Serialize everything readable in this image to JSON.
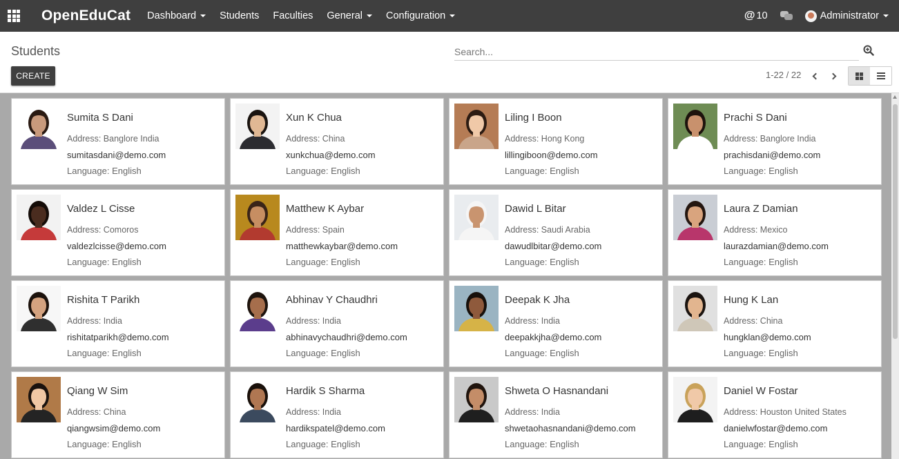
{
  "navbar": {
    "brand": "OpenEduCat",
    "menu": [
      {
        "label": "Dashboard",
        "dropdown": true
      },
      {
        "label": "Students",
        "dropdown": false
      },
      {
        "label": "Faculties",
        "dropdown": false
      },
      {
        "label": "General",
        "dropdown": true
      },
      {
        "label": "Configuration",
        "dropdown": true
      }
    ],
    "mentions_count": "10",
    "user": "Administrator"
  },
  "control_panel": {
    "breadcrumb": "Students",
    "search_placeholder": "Search...",
    "create_label": "CREATE",
    "pager": "1-22 / 22",
    "active_view": "kanban"
  },
  "students": [
    {
      "name": "Sumita S Dani",
      "address": "Address: Banglore India",
      "email": "sumitasdani@demo.com",
      "language": "Language: English",
      "skin": "#c99a7c",
      "hair": "#2a1a12",
      "bg": "#ffffff",
      "shirt": "#5b4e7a"
    },
    {
      "name": "Xun K Chua",
      "address": "Address: China",
      "email": "xunkchua@demo.com",
      "language": "Language: English",
      "skin": "#e0b894",
      "hair": "#1a1410",
      "bg": "#f3f3f3",
      "shirt": "#2b2b30"
    },
    {
      "name": "Liling I Boon",
      "address": "Address: Hong Kong",
      "email": "lillingiboon@demo.com",
      "language": "Language: English",
      "skin": "#f0c9a8",
      "hair": "#2c1b12",
      "bg": "#b57c55",
      "shirt": "#c9a58a"
    },
    {
      "name": "Prachi S Dani",
      "address": "Address: Banglore India",
      "email": "prachisdani@demo.com",
      "language": "Language: English",
      "skin": "#c8916d",
      "hair": "#1d130d",
      "bg": "#6e8c54",
      "shirt": "#ffffff"
    },
    {
      "name": "Valdez L Cisse",
      "address": "Address: Comoros",
      "email": "valdezlcisse@demo.com",
      "language": "Language: English",
      "skin": "#4a2c1f",
      "hair": "#140c08",
      "bg": "#f2f2f2",
      "shirt": "#c53a3a"
    },
    {
      "name": "Matthew K Aybar",
      "address": "Address: Spain",
      "email": "matthewkaybar@demo.com",
      "language": "Language: English",
      "skin": "#c78e62",
      "hair": "#3a2418",
      "bg": "#b8891e",
      "shirt": "#b23a2f"
    },
    {
      "name": "Dawid L Bitar",
      "address": "Address: Saudi Arabia",
      "email": "dawudlbitar@demo.com",
      "language": "Language: English",
      "skin": "#c9946f",
      "hair": "#f5f5f5",
      "bg": "#e9ecef",
      "shirt": "#f5f5f5"
    },
    {
      "name": "Laura Z Damian",
      "address": "Address: Mexico",
      "email": "laurazdamian@demo.com",
      "language": "Language: English",
      "skin": "#d9a47e",
      "hair": "#241610",
      "bg": "#c9cdd4",
      "shirt": "#b8366b"
    },
    {
      "name": "Rishita T Parikh",
      "address": "Address: India",
      "email": "rishitatparikh@demo.com",
      "language": "Language: English",
      "skin": "#d4a27f",
      "hair": "#1c120c",
      "bg": "#f7f7f7",
      "shirt": "#2f2f2f"
    },
    {
      "name": "Abhinav Y Chaudhri",
      "address": "Address: India",
      "email": "abhinavychaudhri@demo.com",
      "language": "Language: English",
      "skin": "#a66e4c",
      "hair": "#1e140e",
      "bg": "#ffffff",
      "shirt": "#5b3d8c"
    },
    {
      "name": "Deepak K Jha",
      "address": "Address: India",
      "email": "deepakkjha@demo.com",
      "language": "Language: English",
      "skin": "#8f5a3c",
      "hair": "#17100b",
      "bg": "#9ab4c2",
      "shirt": "#d6b347"
    },
    {
      "name": "Hung K Lan",
      "address": "Address: China",
      "email": "hungklan@demo.com",
      "language": "Language: English",
      "skin": "#e2b58f",
      "hair": "#1b1410",
      "bg": "#e0e0e0",
      "shirt": "#cfc7b8"
    },
    {
      "name": "Qiang W Sim",
      "address": "Address: China",
      "email": "qiangwsim@demo.com",
      "language": "Language: English",
      "skin": "#f0c7a4",
      "hair": "#1a120e",
      "bg": "#b07a48",
      "shirt": "#242424"
    },
    {
      "name": "Hardik S Sharma",
      "address": "Address: India",
      "email": "hardikspatel@demo.com",
      "language": "Language: English",
      "skin": "#b07752",
      "hair": "#1a110b",
      "bg": "#ffffff",
      "shirt": "#3b4a5e"
    },
    {
      "name": "Shweta O Hasnandani",
      "address": "Address: India",
      "email": "shwetaohasnandani@demo.com",
      "language": "Language: English",
      "skin": "#c48d68",
      "hair": "#20140d",
      "bg": "#c9c9c9",
      "shirt": "#1f1f1f"
    },
    {
      "name": "Daniel W Fostar",
      "address": "Address: Houston United States",
      "email": "danielwfostar@demo.com",
      "language": "Language: English",
      "skin": "#f0c9a8",
      "hair": "#c9a25a",
      "bg": "#f3f3f3",
      "shirt": "#1e1e1e"
    }
  ]
}
